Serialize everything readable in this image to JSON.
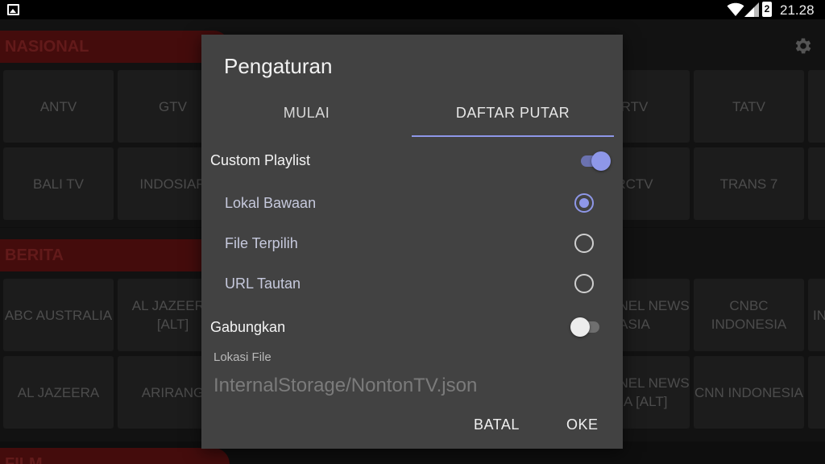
{
  "statusbar": {
    "time": "21.28",
    "battery": "2",
    "icons": [
      "image-icon",
      "wifi-icon",
      "signal-icon",
      "battery-icon"
    ]
  },
  "background": {
    "sections": [
      {
        "title": "NASIONAL"
      },
      {
        "title": "BERITA"
      },
      {
        "title": "FILM"
      }
    ],
    "tiles": {
      "antv": "ANTV",
      "gtv": "GTV",
      "rtv": "RTV",
      "tatv": "TATV",
      "balitv": "BALI TV",
      "indosiar": "INDOSIAR",
      "rctv": "RCTV",
      "trans7": "TRANS 7",
      "abc": "ABC AUSTRALIA",
      "aljazeera_alt": "AL JAZEERA [ALT]",
      "cna": "CHANNEL NEWS ASIA",
      "cnbc": "CNBC INDONESIA",
      "in": "IN",
      "aljazeera": "AL JAZEERA",
      "arirang": "ARIRANG",
      "cna_alt": "CHANNEL NEWS ASIA [ALT]",
      "cnn": "CNN INDONESIA"
    }
  },
  "dialog": {
    "title": "Pengaturan",
    "tabs": [
      {
        "label": "MULAI",
        "selected": false
      },
      {
        "label": "DAFTAR PUTAR",
        "selected": true
      }
    ],
    "custom_playlist": {
      "label": "Custom Playlist",
      "on": true
    },
    "options": [
      {
        "label": "Lokal Bawaan",
        "selected": true
      },
      {
        "label": "File Terpilih",
        "selected": false
      },
      {
        "label": "URL Tautan",
        "selected": false
      }
    ],
    "gabungkan": {
      "label": "Gabungkan",
      "on": false
    },
    "lokasi": {
      "label": "Lokasi File",
      "value": "InternalStorage/NontonTV.json"
    },
    "buttons": {
      "cancel": "BATAL",
      "ok": "OKE"
    }
  },
  "colors": {
    "accent": "#8e97e8",
    "section": "#7d1717",
    "dialog_bg": "#424242"
  }
}
